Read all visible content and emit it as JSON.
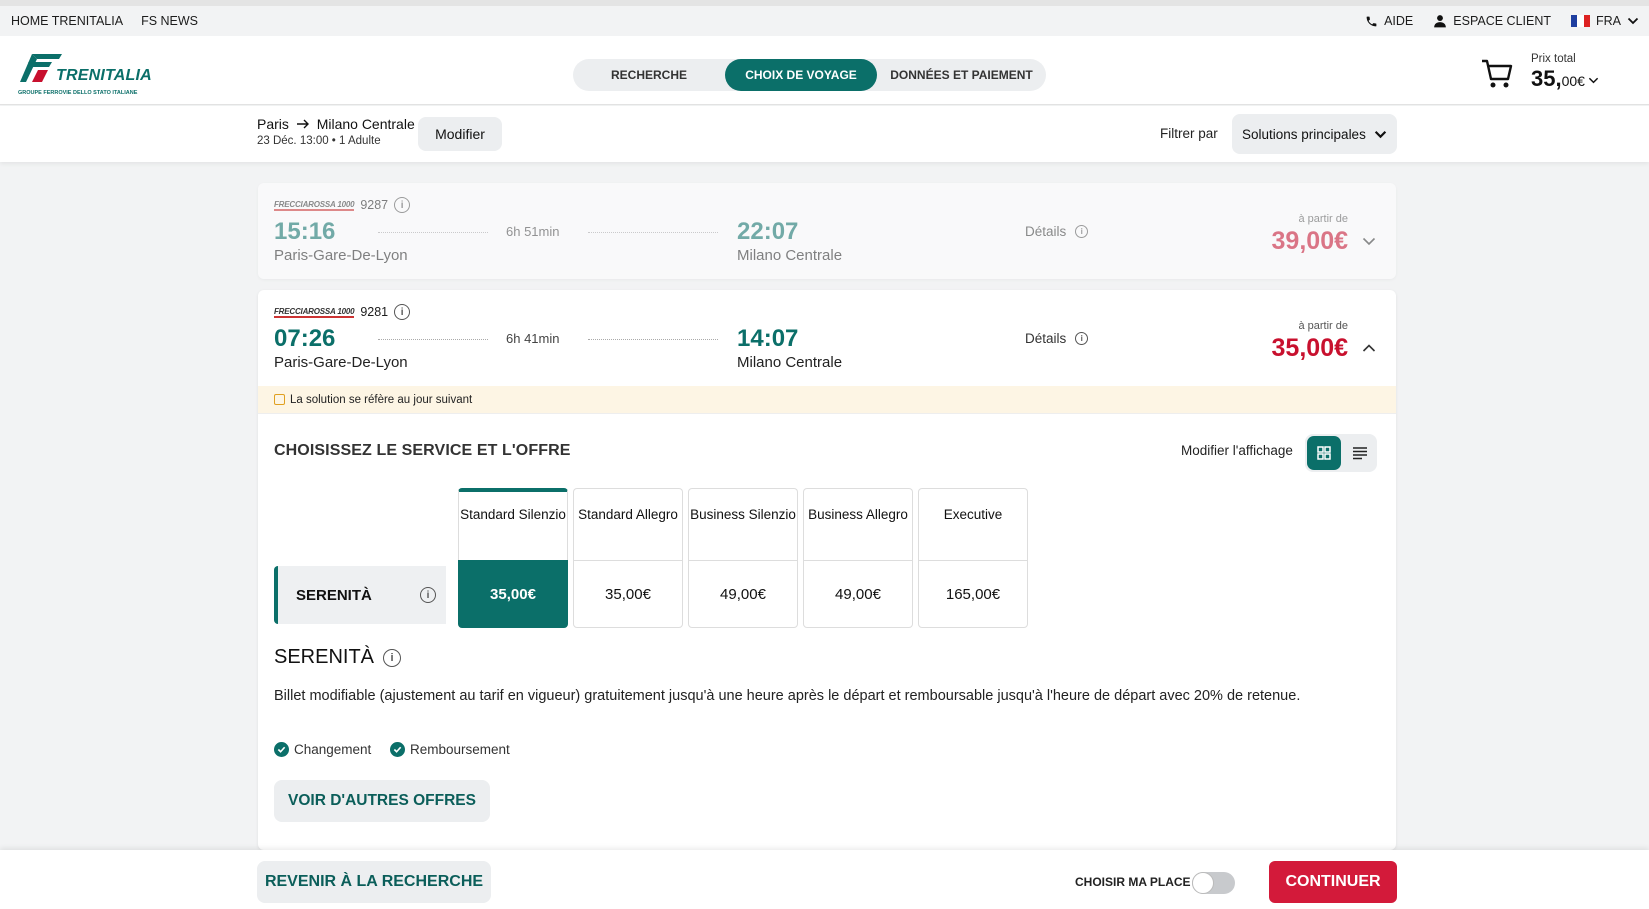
{
  "topbar": {
    "links": [
      "HOME TRENITALIA",
      "FS NEWS"
    ],
    "aide": "AIDE",
    "espace": "ESPACE CLIENT",
    "lang": "FRA"
  },
  "header": {
    "brand": "TRENITALIA",
    "brand_sub": "GROUPE FERROVIE DELLO STATO ITALIANE",
    "steps": [
      "RECHERCHE",
      "CHOIX DE VOYAGE",
      "DONNÉES ET PAIEMENT"
    ],
    "total_label": "Prix total",
    "total_int": "35,",
    "total_dec": "00€"
  },
  "subbar": {
    "from": "Paris",
    "to": "Milano Centrale",
    "details": "23 Déc. 13:00 • 1 Adulte",
    "modify": "Modifier",
    "filter_label": "Filtrer par",
    "filter_value": "Solutions principales"
  },
  "trains": [
    {
      "brand": "FRECCIAROSSA 1000",
      "number": "9287",
      "dep_time": "15:16",
      "dep_station": "Paris-Gare-De-Lyon",
      "duration": "6h 51min",
      "arr_time": "22:07",
      "arr_station": "Milano Centrale",
      "details": "Détails",
      "from_label": "à partir de",
      "price": "39,00€"
    },
    {
      "brand": "FRECCIAROSSA 1000",
      "number": "9281",
      "dep_time": "07:26",
      "dep_station": "Paris-Gare-De-Lyon",
      "duration": "6h 41min",
      "arr_time": "14:07",
      "arr_station": "Milano Centrale",
      "details": "Détails",
      "from_label": "à partir de",
      "price": "35,00€",
      "notice": "La solution se réfère au jour suivant"
    }
  ],
  "offers": {
    "title": "CHOISISSEZ LE SERVICE ET L'OFFRE",
    "view_label": "Modifier l'affichage",
    "row_label": "SERENITÀ",
    "services": [
      {
        "name": "Standard Silenzio",
        "price": "35,00€"
      },
      {
        "name": "Standard Allegro",
        "price": "35,00€"
      },
      {
        "name": "Business Silenzio",
        "price": "49,00€"
      },
      {
        "name": "Business Allegro",
        "price": "49,00€"
      },
      {
        "name": "Executive",
        "price": "165,00€"
      }
    ],
    "selected_title": "SERENITÀ",
    "description": "Billet modifiable (ajustement au tarif en vigueur) gratuitement jusqu'à une heure après le départ et remboursable jusqu'à l'heure de départ avec 20% de retenue.",
    "features": [
      "Changement",
      "Remboursement"
    ],
    "more": "VOIR D'AUTRES OFFRES"
  },
  "footer": {
    "back": "REVENIR À LA RECHERCHE",
    "seat": "CHOISIR MA PLACE",
    "continue": "CONTINUER"
  },
  "colors": {
    "primary": "#0b6f69",
    "accent": "#c8102e"
  }
}
